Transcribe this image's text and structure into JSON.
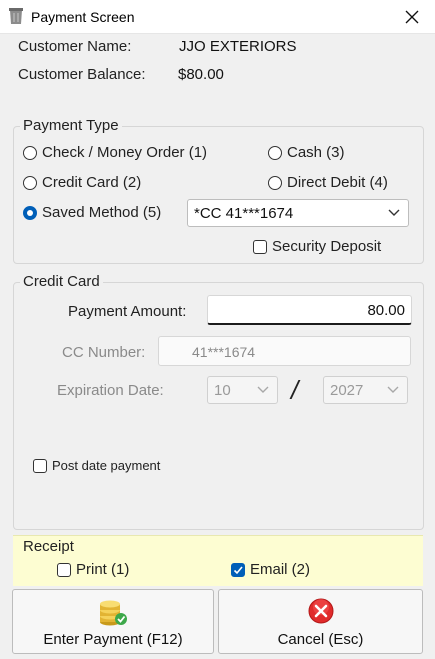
{
  "window": {
    "title": "Payment Screen"
  },
  "customer": {
    "name_label": "Customer Name:",
    "name_value": "JJO EXTERIORS",
    "balance_label": "Customer Balance:",
    "balance_value": "$80.00"
  },
  "payment_type": {
    "title": "Payment Type",
    "options": [
      {
        "label": "Check / Money Order (1)",
        "checked": false
      },
      {
        "label": "Cash (3)",
        "checked": false
      },
      {
        "label": "Credit Card (2)",
        "checked": false
      },
      {
        "label": "Direct Debit (4)",
        "checked": false
      },
      {
        "label": "Saved Method (5)",
        "checked": true
      }
    ],
    "saved_method_value": "*CC 41***1674",
    "security_deposit_label": "Security Deposit",
    "security_deposit_checked": false
  },
  "credit_card": {
    "title": "Credit Card",
    "amount_label": "Payment Amount:",
    "amount_value": "80.00",
    "cc_number_label": "CC Number:",
    "cc_number_value": "41***1674",
    "expiration_label": "Expiration Date:",
    "exp_month": "10",
    "exp_separator": "/",
    "exp_year": "2027",
    "post_date_label": "Post date payment",
    "post_date_checked": false
  },
  "receipt": {
    "title": "Receipt",
    "print_label": "Print (1)",
    "print_checked": false,
    "email_label": "Email (2)",
    "email_checked": true
  },
  "actions": {
    "enter_label": "Enter Payment (F12)",
    "cancel_label": "Cancel (Esc)"
  },
  "colors": {
    "accent": "#005fb8",
    "receipt_bg": "#fdfdd2",
    "cancel_red": "#e02b2b"
  },
  "icons": {
    "window": "trash-can-icon",
    "close": "close-icon",
    "enter": "coin-stack-icon",
    "cancel": "cancel-x-icon"
  }
}
